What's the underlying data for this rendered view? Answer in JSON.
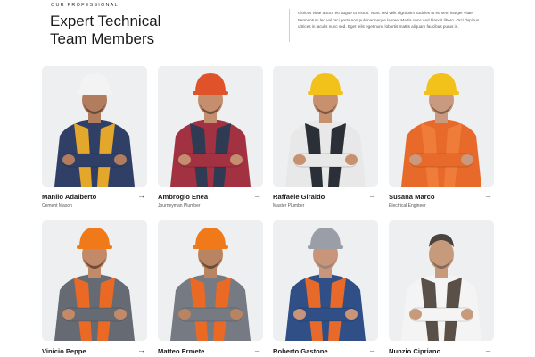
{
  "header": {
    "eyebrow": "OUR PROFESSIONAL",
    "title_line1": "Expert Technical",
    "title_line2": "Team Members",
    "intro": "Ultrices vitae auctor eu augue ut lectus. Nunc sed velit dignissim sodales ut eu sem integer vitae. Fermentum leo vel orci porta non pulvinar neque laoreet Mattis nunc sed blandit libero. Orci dapibus ultrices in iaculis nunc sed. Eget felis eget nunc lobortis mattis aliquam faucibus purus in."
  },
  "team": [
    {
      "name": "Manlio Adalberto",
      "role": "Cement Mason",
      "helmet": "#f3f3f3",
      "shirt": "#2f3f66",
      "vest": "#e3a72c",
      "skin": "#b27c5e",
      "hair": "#2b1d16"
    },
    {
      "name": "Ambrogio Enea",
      "role": "Journeyman Plumber",
      "helmet": "#e0522a",
      "shirt": "#a23142",
      "vest": "#2e3b52",
      "skin": "#c58e6e",
      "hair": "#2b1d16"
    },
    {
      "name": "Raffaele Giraldo",
      "role": "Master Plumber",
      "helmet": "#f2c21a",
      "shirt": "#e8e8e8",
      "vest": "#2b2f38",
      "skin": "#c7906e",
      "hair": "#3a2a20"
    },
    {
      "name": "Susana Marco",
      "role": "Electrical Engineer",
      "helmet": "#f2c21a",
      "shirt": "#e86a2a",
      "vest": "#f07c3a",
      "skin": "#c99a80",
      "hair": "#4a3325"
    },
    {
      "name": "Vinicio Peppe",
      "role": "",
      "helmet": "#f07a1a",
      "shirt": "#666a72",
      "vest": "#ea6a25",
      "skin": "#c28a68",
      "hair": "#2b1d16"
    },
    {
      "name": "Matteo Ermete",
      "role": "",
      "helmet": "#f07a1a",
      "shirt": "#767a82",
      "vest": "#ea6a25",
      "skin": "#b98462",
      "hair": "#2b1d16"
    },
    {
      "name": "Roberto Gastone",
      "role": "",
      "helmet": "#9a9ea6",
      "shirt": "#2f4f86",
      "vest": "#e86a2a",
      "skin": "#c8957a",
      "hair": "#777"
    },
    {
      "name": "Nunzio Cipriano",
      "role": "",
      "helmet": "",
      "shirt": "#f4f4f4",
      "vest": "#5a5048",
      "skin": "#c89a7c",
      "hair": "#4a4440"
    }
  ],
  "icons": {
    "arrow": "→"
  }
}
